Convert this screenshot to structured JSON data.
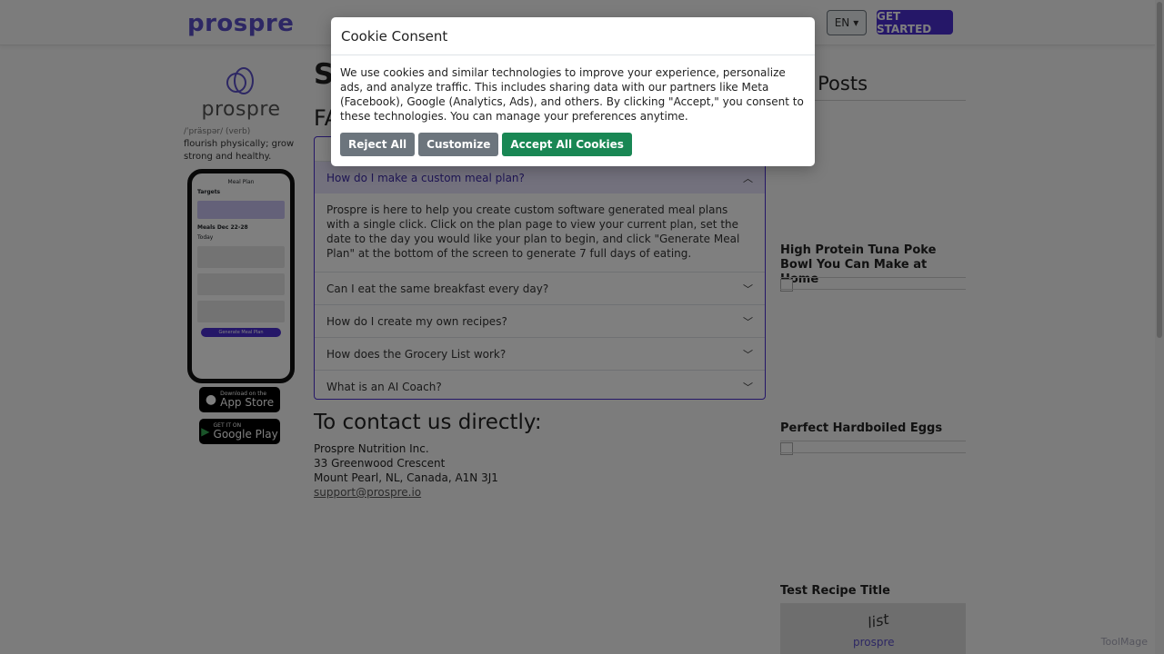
{
  "nav": {
    "brand": "prospre",
    "lang": "EN",
    "cta": "GET STARTED"
  },
  "sidebar": {
    "logo_word": "prospre",
    "pronunciation": "/ˈpräspər/ (verb)",
    "definition": "flourish physically; grow strong and healthy.",
    "app_store": {
      "sub": "Download on the",
      "main": "App Store"
    },
    "google_play": {
      "sub": "GET IT ON",
      "main": "Google Play"
    },
    "phone": {
      "title": "Meal Plan",
      "targets": "Targets",
      "meals": "Meals",
      "date": "Dec 22-28",
      "today": "Today",
      "button": "Generate Meal Plan"
    }
  },
  "main": {
    "heading_partial": "S",
    "faq_partial": "FA",
    "faq": [
      {
        "q": "How do I make a custom meal plan?",
        "a": "Prospre is here to help you create custom software generated meal plans with a single click. Click on the plan page to view your current plan, set the date to the day you would like your plan to begin, and click \"Generate Meal Plan\" at the bottom of the screen to generate 7 full days of eating.",
        "open": true
      },
      {
        "q": "Can I eat the same breakfast every day?"
      },
      {
        "q": "How do I create my own recipes?"
      },
      {
        "q": "How does the Grocery List work?"
      },
      {
        "q": "What is an AI Coach?"
      }
    ],
    "contact": {
      "heading": "To contact us directly:",
      "company": "Prospre Nutrition Inc.",
      "street": "33 Greenwood Crescent",
      "city": "Mount Pearl, NL, Canada, A1N 3J1",
      "email": "support@prospre.io"
    }
  },
  "recent": {
    "heading_partial": "ent Posts",
    "posts": [
      {
        "title": "High Protein Tuna Poke Bowl You Can Make at Home"
      },
      {
        "title": "Perfect Hardboiled Eggs"
      },
      {
        "title": "Test Recipe Title"
      }
    ],
    "thumb_text": "list",
    "thumb_brand": "prospre"
  },
  "watermark": "ToolMage",
  "cookie": {
    "title": "Cookie Consent",
    "body": "We use cookies and similar technologies to improve your experience, personalize ads, and analyze traffic. This includes sharing data with our partners like Meta (Facebook), Google (Analytics, Ads), and others. By clicking \"Accept,\" you consent to these technologies. You can manage your preferences anytime.",
    "reject": "Reject All",
    "customize": "Customize",
    "accept": "Accept All Cookies"
  }
}
